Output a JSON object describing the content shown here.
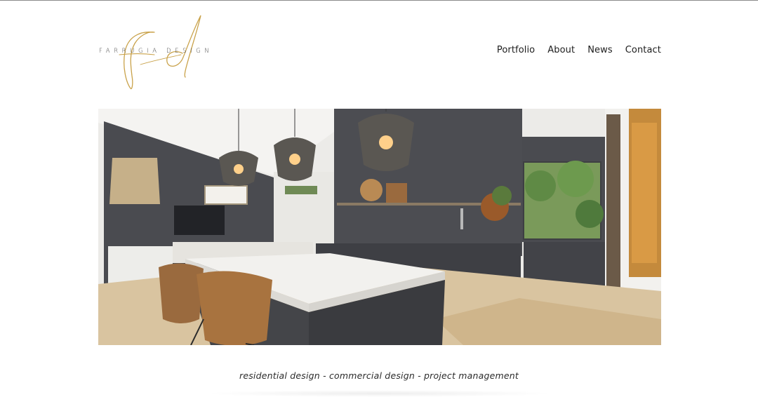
{
  "brand": {
    "name": "FARRUGIA DESIGN",
    "accent_color": "#c9a24a"
  },
  "nav": {
    "items": [
      {
        "label": "Portfolio"
      },
      {
        "label": "About"
      },
      {
        "label": "News"
      },
      {
        "label": "Contact"
      }
    ]
  },
  "hero": {
    "image": "kitchen-interior-photo"
  },
  "tagline": "residential design - commercial design - project management"
}
